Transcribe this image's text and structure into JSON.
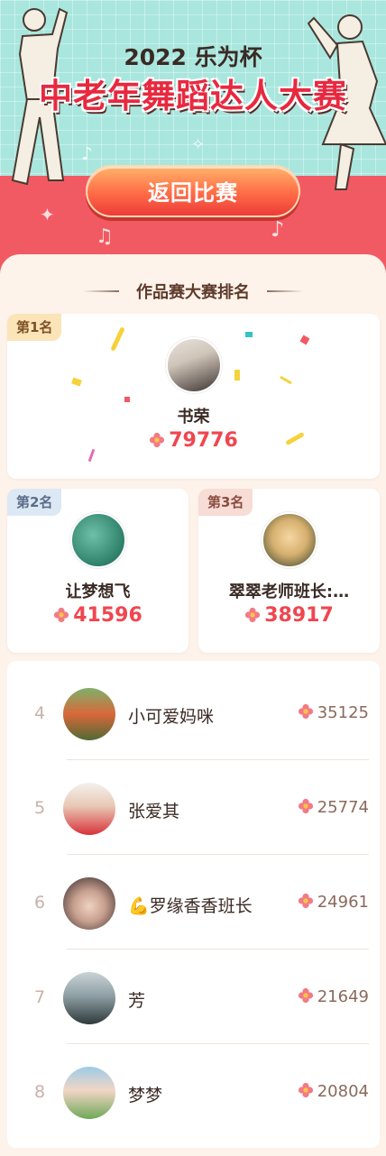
{
  "header": {
    "year_title": "2022 乐为杯",
    "main_title": "中老年舞蹈达人大赛",
    "back_button": "返回比赛"
  },
  "ranking": {
    "section_title": "作品赛大赛排名",
    "top": [
      {
        "tag": "第1名",
        "name": "书荣",
        "votes": "79776"
      },
      {
        "tag": "第2名",
        "name": "让梦想飞",
        "votes": "41596"
      },
      {
        "tag": "第3名",
        "name": "翠翠老师班长:…",
        "votes": "38917"
      }
    ],
    "list": [
      {
        "rank": "4",
        "name": "小可爱妈咪",
        "votes": "35125"
      },
      {
        "rank": "5",
        "name": "张爱其",
        "votes": "25774"
      },
      {
        "rank": "6",
        "name": "罗缘香香班长",
        "votes": "24961"
      },
      {
        "rank": "7",
        "name": "芳",
        "votes": "21649"
      },
      {
        "rank": "8",
        "name": "梦梦",
        "votes": "20804"
      }
    ]
  },
  "colors": {
    "accent": "#f0464f",
    "header_bg": "#a9e6de",
    "page_bg": "#f25a63",
    "card_bg": "#fdf3ea"
  },
  "icons": {
    "vote": "flower-icon",
    "emoji_row6": "flexed-biceps-icon"
  }
}
